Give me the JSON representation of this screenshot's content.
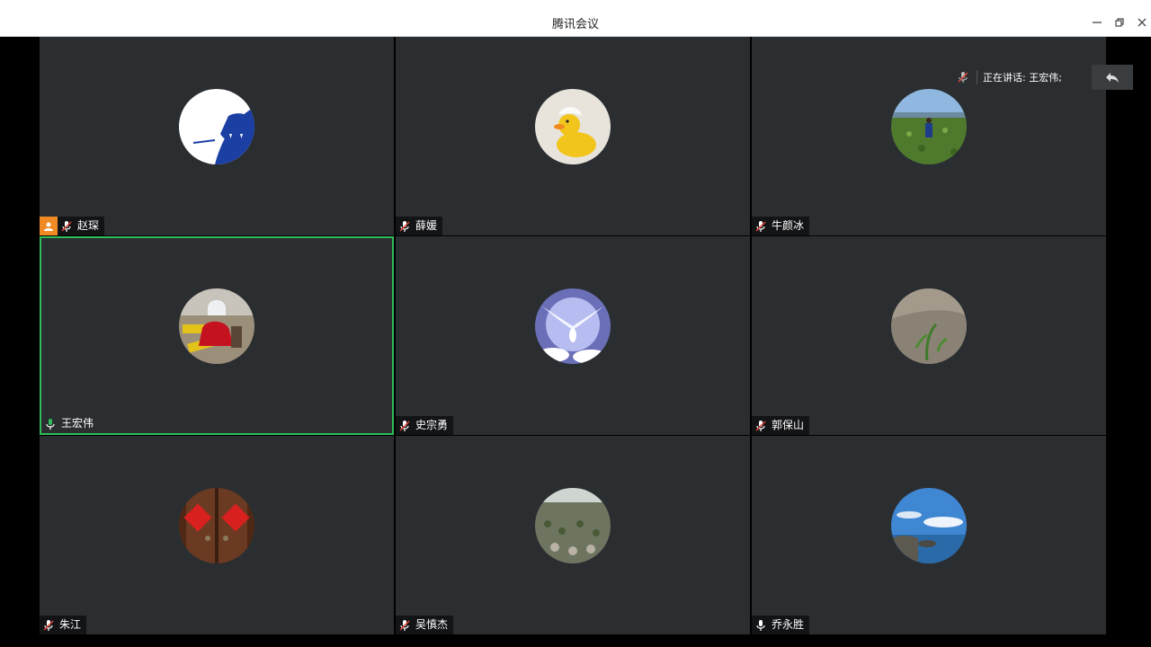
{
  "window": {
    "title": "腾讯会议"
  },
  "speaking": {
    "text": "正在讲话: 王宏伟;"
  },
  "participants": [
    {
      "name": "赵琛",
      "mic": "muted",
      "host": true
    },
    {
      "name": "薛媛",
      "mic": "muted"
    },
    {
      "name": "牛颜冰",
      "mic": "muted"
    },
    {
      "name": "王宏伟",
      "mic": "on",
      "active": true
    },
    {
      "name": "史宗勇",
      "mic": "muted"
    },
    {
      "name": "郭保山",
      "mic": "muted"
    },
    {
      "name": "朱江",
      "mic": "muted"
    },
    {
      "name": "吴慎杰",
      "mic": "muted"
    },
    {
      "name": "乔永胜",
      "mic": "on"
    }
  ],
  "colors": {
    "tile_bg": "#2b2e31",
    "active_border": "#2ebd59",
    "host_badge": "#f08a24"
  }
}
